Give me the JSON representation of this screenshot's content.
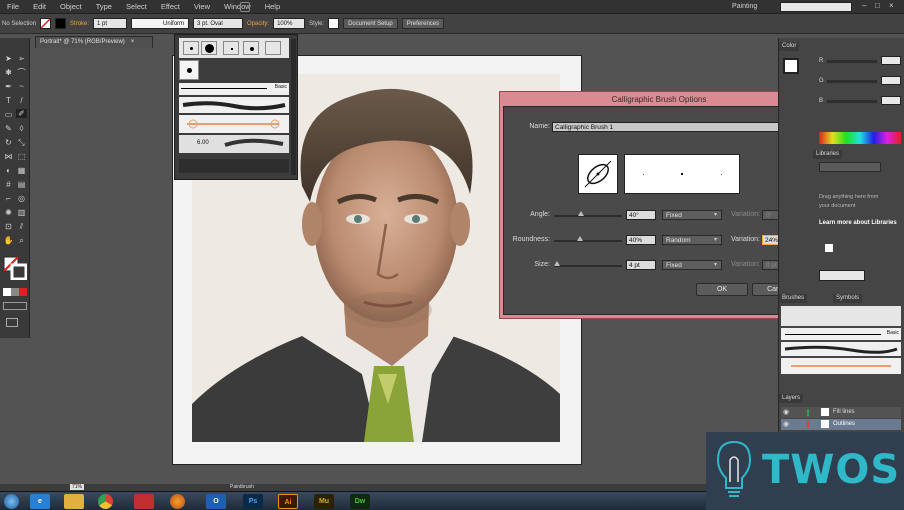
{
  "menu": {
    "items": [
      "File",
      "Edit",
      "Object",
      "Type",
      "Select",
      "Effect",
      "View",
      "Window",
      "Help"
    ],
    "workspace": "Painting"
  },
  "control": {
    "selection": "No Selection",
    "stroke_label": "Stroke:",
    "stroke_value": "1 pt",
    "profile": "Uniform",
    "brush": "3 pt. Oval",
    "opacity_label": "Opacity:",
    "opacity_value": "100%",
    "style_label": "Style:",
    "doc_setup": "Document Setup",
    "preferences": "Preferences"
  },
  "document": {
    "tab": "Portrait* @ 71% (RGB/Preview)"
  },
  "brushes": {
    "basic_label": "Basic",
    "size_value": "6.00"
  },
  "dialog": {
    "title": "Calligraphic Brush Options",
    "name_label": "Name:",
    "name_value": "Calligraphic Brush 1",
    "angle_label": "Angle:",
    "angle_value": "40°",
    "angle_mode": "Fixed",
    "angle_variation_label": "Variation:",
    "angle_variation_value": "0°",
    "roundness_label": "Roundness:",
    "roundness_value": "40%",
    "roundness_mode": "Random",
    "roundness_variation_label": "Variation:",
    "roundness_variation_value": "24%",
    "size_label": "Size:",
    "size_value": "4 pt",
    "size_mode": "Fixed",
    "size_variation_label": "Variation:",
    "size_variation_value": "0 pt",
    "ok": "OK",
    "cancel": "Cancel",
    "angle_fraction": 0.4,
    "roundness_fraction": 0.38,
    "size_fraction": 0.04
  },
  "right_panels": {
    "color_tab": "Color",
    "r_label": "R",
    "g_label": "G",
    "b_label": "B",
    "libraries_tab": "Libraries",
    "libraries_text1": "Drag anything here from",
    "libraries_text2": "your document",
    "libraries_link": "Learn more about Libraries",
    "brush_tab": "Brushes",
    "symbols_tab": "Symbols",
    "basic_label": "Basic",
    "layers_tab": "Layers",
    "layer1": "Fill lines",
    "layer2": "Outlines"
  },
  "status": {
    "zoom": "71%",
    "tool": "Paintbrush"
  },
  "taskbar": {
    "apps": [
      "Ps",
      "Ai",
      "Mu",
      "Dw"
    ]
  },
  "logo": {
    "text": "TWOS"
  },
  "colors": {
    "dialog_frame": "#d98a92",
    "accent_orange": "#f0a04a",
    "ai_icon": "#f09000",
    "ps_icon": "#2a6ab2",
    "mu_icon": "#c8a000",
    "dw_icon": "#4a9a3a",
    "logo_cyan": "#2fb8c8"
  }
}
